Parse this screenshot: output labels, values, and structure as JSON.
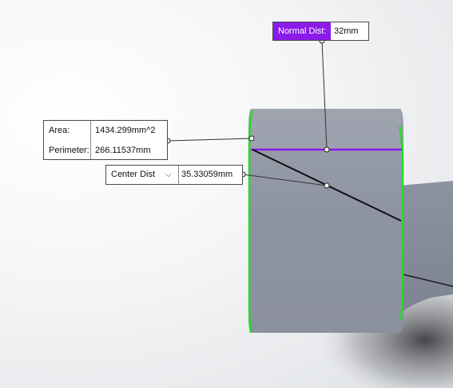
{
  "area_callout": {
    "area_label": "Area:",
    "area_value": "1434.299mm^2",
    "perimeter_label": "Perimeter:",
    "perimeter_value": "266.11537mm"
  },
  "center_callout": {
    "mode_label": "Center Dist",
    "mode_icon": "chevron-down-icon",
    "value": "35.33059mm"
  },
  "normal_callout": {
    "label": "Normal Dist:",
    "value": "32mm"
  },
  "colors": {
    "measure_purple": "#8a1be8",
    "edge_green": "#22dd22",
    "body_gray": "#8e94a4"
  }
}
